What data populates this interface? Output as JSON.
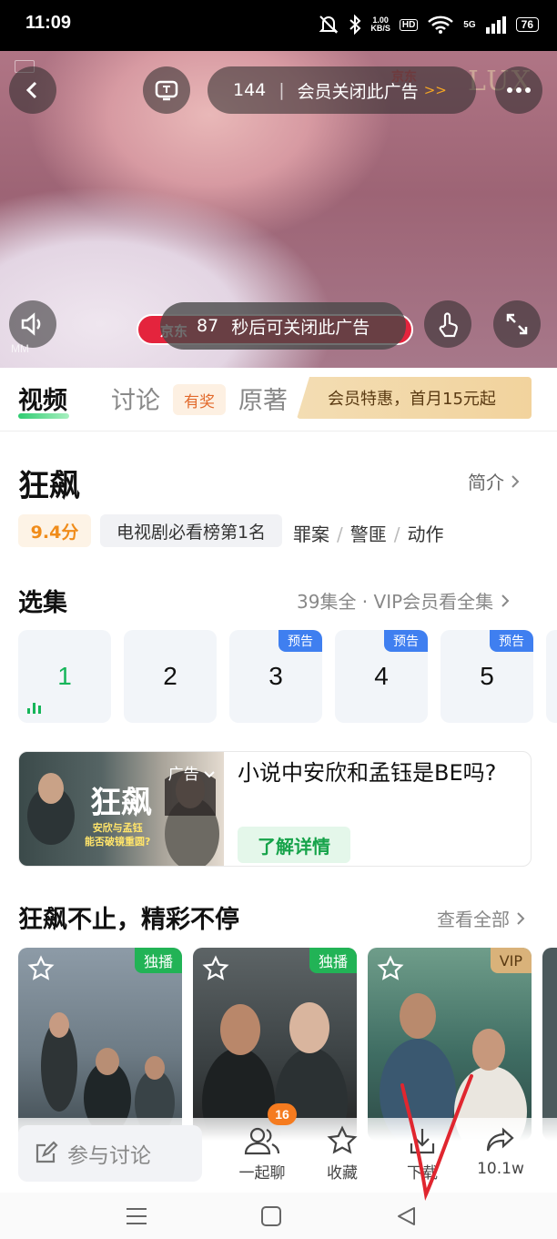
{
  "status_bar": {
    "time": "11:09",
    "net_speed_value": "1.00",
    "net_speed_unit": "KB/S",
    "hd": "HD",
    "net_type": "5G",
    "battery": "76"
  },
  "player": {
    "ad_countdown": "144",
    "ad_close_text": "会员关闭此广告",
    "ad_close_arrows": ">>",
    "skip_seconds": "87",
    "skip_text": "秒后可关闭此广告",
    "mm_label": "MM",
    "lux_logo": "LUX",
    "jd_logo": "京东",
    "jd_tag": "京东"
  },
  "tabs": {
    "video": "视频",
    "discussion": "讨论",
    "prize_badge": "有奖",
    "original": "原著",
    "vip_promo": "会员特惠，首月15元起"
  },
  "show": {
    "title": "狂飙",
    "intro_link": "简介",
    "score": "9.4分",
    "rank": "电视剧必看榜第1名",
    "genres": [
      "罪案",
      "警匪",
      "动作"
    ]
  },
  "episodes": {
    "heading": "选集",
    "summary": "39集全 · VIP会员看全集",
    "items": [
      {
        "number": "1",
        "badge": ""
      },
      {
        "number": "2",
        "badge": ""
      },
      {
        "number": "3",
        "badge": "预告"
      },
      {
        "number": "4",
        "badge": "预告"
      },
      {
        "number": "5",
        "badge": "预告"
      }
    ]
  },
  "ad_card": {
    "poster_title": "狂飙",
    "poster_line1": "安欣与孟钰",
    "poster_line2": "能否破镜重圆?",
    "ad_label": "广告",
    "headline": "小说中安欣和孟钰是BE吗?",
    "cta": "了解详情"
  },
  "recommend": {
    "heading": "狂飙不止，精彩不停",
    "see_all": "查看全部",
    "posters": [
      {
        "tag": "独播",
        "tag_color": "#22b356"
      },
      {
        "tag": "独播",
        "tag_color": "#22b356"
      },
      {
        "tag": "VIP",
        "tag_color": "#d9b27a"
      }
    ]
  },
  "bottom_bar": {
    "discuss_placeholder": "参与讨论",
    "chat_label": "一起聊",
    "chat_count": "16",
    "favorite_label": "收藏",
    "download_label": "下载",
    "share_count": "10.1w"
  },
  "colors": {
    "accent_green": "#16b55a",
    "episode_badge": "#3f7ff0",
    "score_orange": "#f08c1a",
    "annotation_red": "#e0262f"
  }
}
